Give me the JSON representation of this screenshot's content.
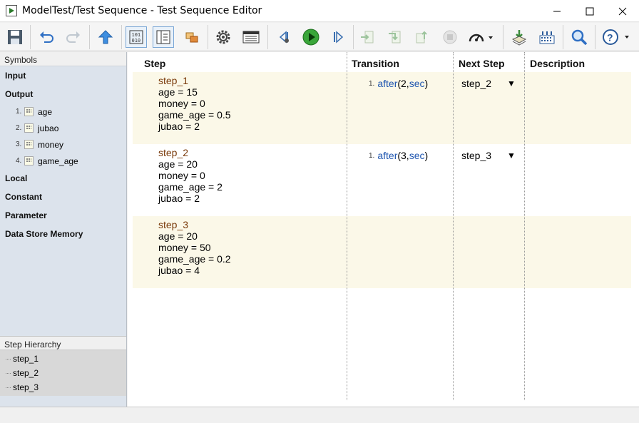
{
  "window": {
    "title": "ModelTest/Test Sequence - Test Sequence Editor"
  },
  "toolbar": {
    "buttons": [
      "save-icon",
      "undo-icon",
      "redo-icon",
      "up-arrow-icon",
      "data-symbols-icon",
      "symbols-pane-icon",
      "model-explorer-icon",
      "settings-gear-icon",
      "table-view-icon",
      "step-back-icon",
      "run-icon",
      "step-forward-icon",
      "step-into-icon",
      "step-over-icon",
      "step-out-icon",
      "stop-icon",
      "pacing-icon",
      "load-icon",
      "signal-icon",
      "search-icon",
      "help-icon"
    ],
    "accent": "#2f6fc4"
  },
  "symbols": {
    "header": "Symbols",
    "sections": {
      "input": "Input",
      "output": "Output",
      "local": "Local",
      "constant": "Constant",
      "parameter": "Parameter",
      "data_store": "Data Store Memory"
    },
    "outputs": [
      {
        "num": "1.",
        "name": "age"
      },
      {
        "num": "2.",
        "name": "jubao"
      },
      {
        "num": "3.",
        "name": "money"
      },
      {
        "num": "4.",
        "name": "game_age"
      }
    ]
  },
  "hierarchy": {
    "header": "Step Hierarchy",
    "items": [
      "step_1",
      "step_2",
      "step_3"
    ]
  },
  "table": {
    "headers": {
      "step": "Step",
      "transition": "Transition",
      "next_step": "Next Step",
      "description": "Description"
    },
    "rows": [
      {
        "name": "step_1",
        "lines": [
          "age = 15",
          "money = 0",
          "game_age = 0.5",
          "jubao = 2"
        ],
        "transition": {
          "num": "1.",
          "fn": "after",
          "open": "(2,",
          "unit": "sec",
          "close": ")"
        },
        "next": "step_2",
        "arrow": "▼",
        "description": ""
      },
      {
        "name": "step_2",
        "lines": [
          "age = 20",
          "money = 0",
          "game_age = 2",
          "jubao = 2"
        ],
        "transition": {
          "num": "1.",
          "fn": "after",
          "open": "(3,",
          "unit": "sec",
          "close": ")"
        },
        "next": "step_3",
        "arrow": "▼",
        "description": ""
      },
      {
        "name": "step_3",
        "lines": [
          "age = 20",
          "money = 50",
          "game_age = 0.2",
          "jubao = 4"
        ],
        "transition": null,
        "next": "",
        "arrow": "",
        "description": ""
      }
    ]
  },
  "colors": {
    "row_shade": "#fbf8e8",
    "step_name": "#7a3a0a",
    "keyword": "#1f56b0",
    "panel_bg": "#dce3ec"
  }
}
